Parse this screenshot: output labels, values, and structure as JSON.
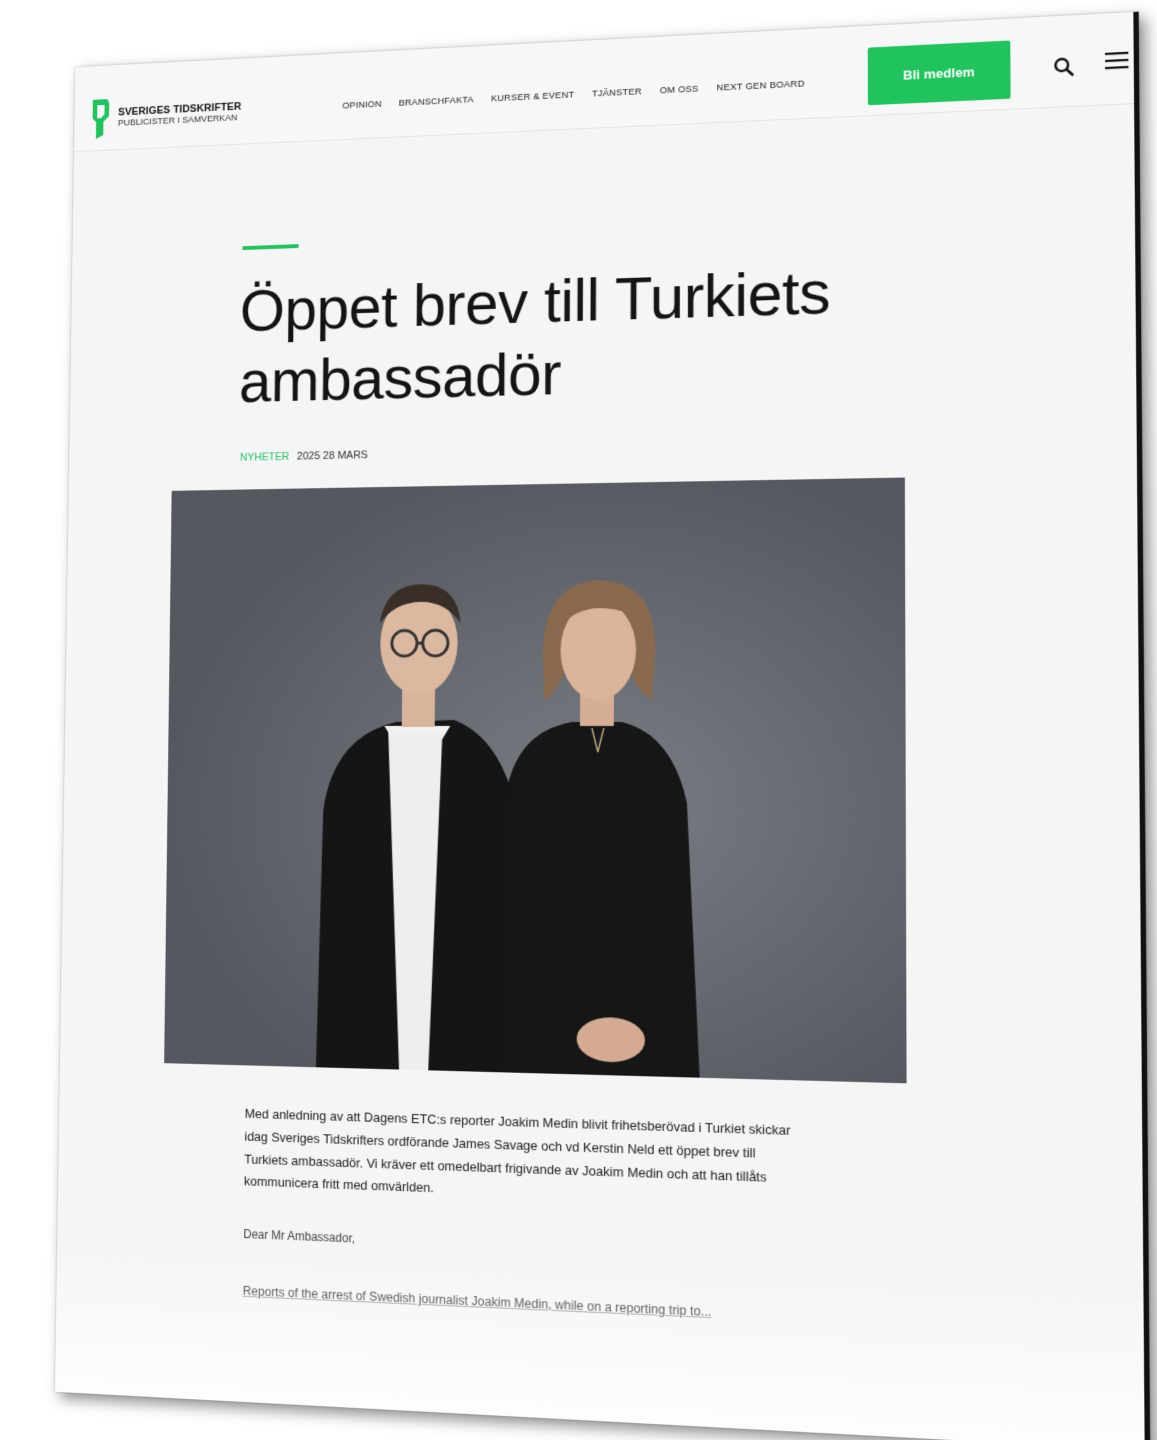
{
  "header": {
    "logo_title": "SVERIGES TIDSKRIFTER",
    "logo_subtitle": "PUBLICISTER I SAMVERKAN",
    "nav": [
      {
        "label": "OPINION"
      },
      {
        "label": "BRANSCHFAKTA"
      },
      {
        "label": "KURSER & EVENT"
      },
      {
        "label": "TJÄNSTER"
      },
      {
        "label": "OM OSS"
      },
      {
        "label": "NEXT GEN BOARD"
      }
    ],
    "join_button": "Bli medlem",
    "search_icon": "search-icon",
    "menu_icon": "hamburger-menu-icon"
  },
  "article": {
    "title": "Öppet brev till Turkiets ambassadör",
    "category": "NYHETER",
    "date": "2025 28 MARS",
    "lead": "Med anledning av att Dagens ETC:s reporter Joakim Medin blivit frihetsberövad i Turkiet skickar idag Sveriges Tidskrifters ordförande James Savage och vd Kerstin Neld ett öppet brev till Turkiets ambassadör. Vi kräver ett omedelbart frigivande av Joakim Medin och att han tillåts kommunicera fritt med omvärlden.",
    "salutation": "Dear Mr Ambassador,",
    "body_first_line": "Reports of the arrest of Swedish journalist Joakim Medin, while on a reporting trip to..."
  },
  "colors": {
    "accent": "#20c35d",
    "text": "#141414",
    "page_bg": "#f5f5f5"
  }
}
